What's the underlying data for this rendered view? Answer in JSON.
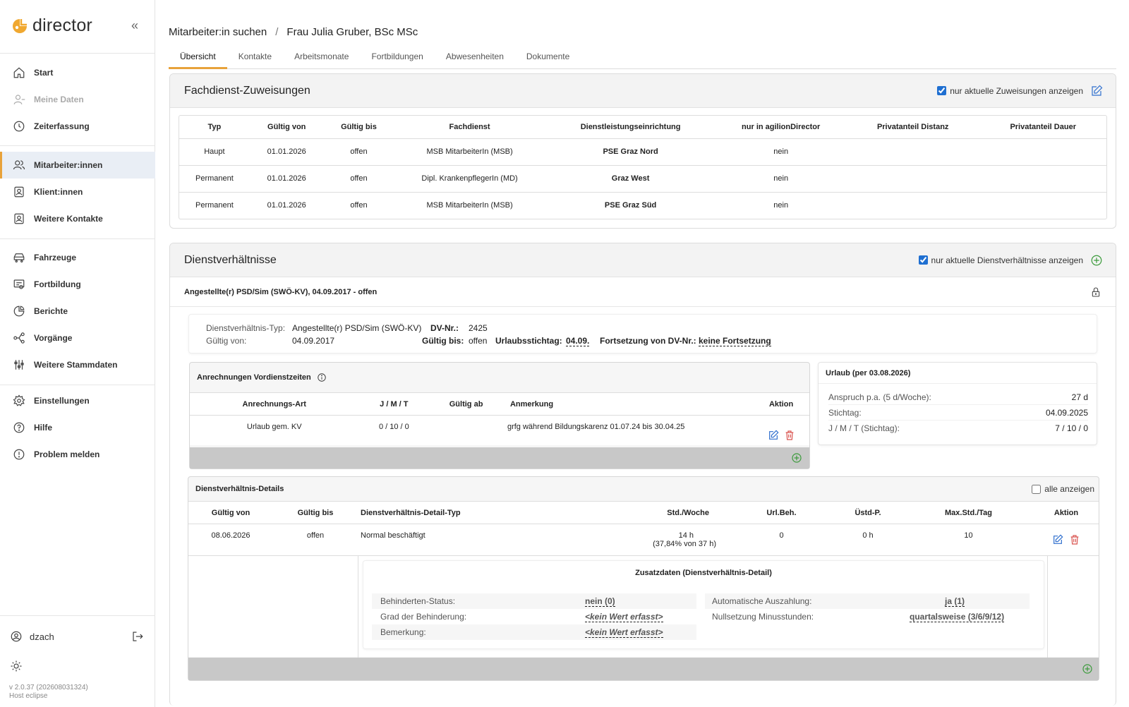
{
  "app": {
    "name": "director",
    "user": "dzach",
    "version": "v 2.0.37 (202608031324)",
    "host": "Host eclipse"
  },
  "sidebar": {
    "items": [
      {
        "label": "Start"
      },
      {
        "label": "Meine Daten"
      },
      {
        "label": "Zeiterfassung"
      },
      {
        "label": "Mitarbeiter:innen"
      },
      {
        "label": "Klient:innen"
      },
      {
        "label": "Weitere Kontakte"
      },
      {
        "label": "Fahrzeuge"
      },
      {
        "label": "Fortbildung"
      },
      {
        "label": "Berichte"
      },
      {
        "label": "Vorgänge"
      },
      {
        "label": "Weitere Stammdaten"
      },
      {
        "label": "Einstellungen"
      },
      {
        "label": "Hilfe"
      },
      {
        "label": "Problem melden"
      }
    ]
  },
  "breadcrumb": {
    "parent": "Mitarbeiter:in suchen",
    "current": "Frau Julia Gruber, BSc MSc"
  },
  "tabs": [
    "Übersicht",
    "Kontakte",
    "Arbeitsmonate",
    "Fortbildungen",
    "Abwesenheiten",
    "Dokumente"
  ],
  "fachdienst": {
    "title": "Fachdienst-Zuweisungen",
    "checkbox_label": "nur aktuelle Zuweisungen anzeigen",
    "columns": [
      "Typ",
      "Gültig von",
      "Gültig bis",
      "Fachdienst",
      "Dienstleistungseinrichtung",
      "nur in agilionDirector",
      "Privatanteil Distanz",
      "Privatanteil Dauer"
    ],
    "rows": [
      [
        "Haupt",
        "01.01.2026",
        "offen",
        "MSB MitarbeiterIn (MSB)",
        "PSE Graz Nord",
        "nein",
        "",
        ""
      ],
      [
        "Permanent",
        "01.01.2026",
        "offen",
        "Dipl. KrankenpflegerIn (MD)",
        "Graz West",
        "nein",
        "",
        ""
      ],
      [
        "Permanent",
        "01.01.2026",
        "offen",
        "MSB MitarbeiterIn (MSB)",
        "PSE Graz Süd",
        "nein",
        "",
        ""
      ]
    ]
  },
  "dienstverhaeltnisse": {
    "title": "Dienstverhältnisse",
    "checkbox_label": "nur aktuelle Dienstverhältnisse anzeigen",
    "entry_title": "Angestellte(r) PSD/Sim (SWÖ-KV), 04.09.2017 - offen",
    "info": {
      "typ_label": "Dienstverhältnis-Typ:",
      "typ_value": "Angestellte(r) PSD/Sim (SWÖ-KV)",
      "dvnr_label": "DV-Nr.:",
      "dvnr_value": "2425",
      "von_label": "Gültig von:",
      "von_value": "04.09.2017",
      "bis_label": "Gültig bis:",
      "bis_value": "offen",
      "stichtag_label": "Urlaubsstichtag:",
      "stichtag_value": "04.09.",
      "fort_label": "Fortsetzung von DV-Nr.:",
      "fort_value": "keine Fortsetzung"
    },
    "anrechnungen": {
      "title": "Anrechnungen Vordienstzeiten",
      "columns": [
        "Anrechnungs-Art",
        "J / M / T",
        "Gültig ab",
        "Anmerkung",
        "Aktion"
      ],
      "rows": [
        [
          "Urlaub gem. KV",
          "0 / 10 / 0",
          "",
          "grfg während Bildungskarenz 01.07.24 bis 30.04.25"
        ]
      ]
    },
    "urlaub": {
      "title": "Urlaub (per 03.08.2026)",
      "rows": [
        {
          "label": "Anspruch p.a. (5 d/Woche):",
          "value": "27 d"
        },
        {
          "label": "Stichtag:",
          "value": "04.09.2025"
        },
        {
          "label": "J / M / T (Stichtag):",
          "value": "7 / 10 / 0"
        }
      ]
    },
    "details": {
      "title": "Dienstverhältnis-Details",
      "checkbox_label": "alle anzeigen",
      "columns": [
        "Gültig von",
        "Gültig bis",
        "Dienstverhältnis-Detail-Typ",
        "Std./Woche",
        "Url.Beh.",
        "Üstd-P.",
        "Max.Std./Tag",
        "Aktion"
      ],
      "row": {
        "von": "08.06.2026",
        "bis": "offen",
        "typ": "Normal beschäftigt",
        "std": "14 h",
        "std_sub": "(37,84% von 37 h)",
        "url": "0",
        "ustd": "0 h",
        "max": "10"
      },
      "zusatz": {
        "title": "Zusatzdaten (Dienstverhältnis-Detail)",
        "left": [
          {
            "label": "Behinderten-Status:",
            "value": "nein (0)"
          },
          {
            "label": "Grad der Behinderung:",
            "value": "<kein Wert erfasst>"
          },
          {
            "label": "Bemerkung:",
            "value": "<kein Wert erfasst>"
          }
        ],
        "right": [
          {
            "label": "Automatische Auszahlung:",
            "value": "ja (1)"
          },
          {
            "label": "Nullsetzung Minusstunden:",
            "value": "quartalsweise (3/6/9/12)"
          }
        ]
      }
    }
  },
  "colors": {
    "accent": "#e8a23a",
    "link": "#24489b",
    "delete": "#d9534f",
    "add": "#3a9a3a",
    "edit": "#2f6fce"
  }
}
